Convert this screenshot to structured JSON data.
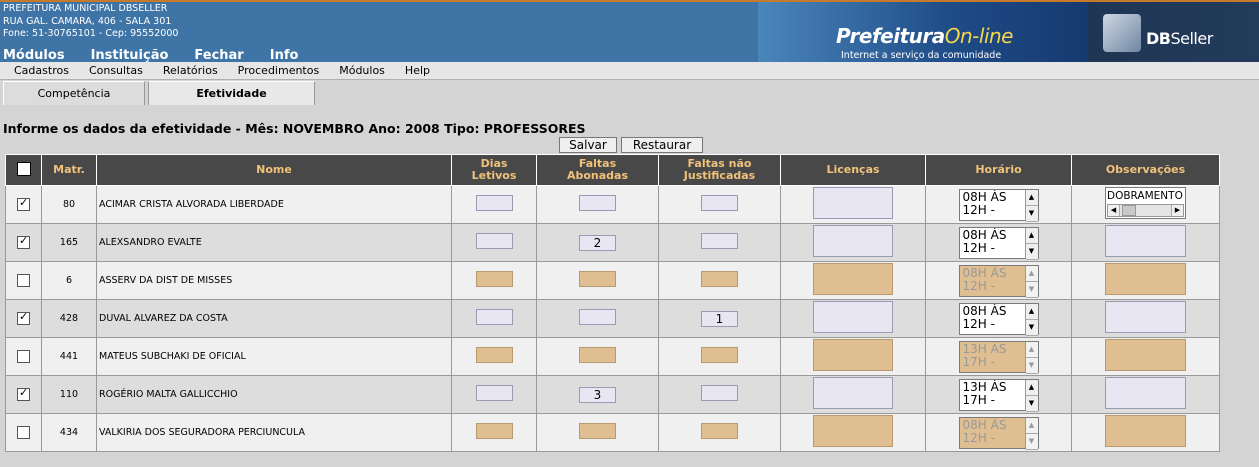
{
  "org": {
    "name": "PREFEITURA MUNICIPAL DBSELLER",
    "address": "RUA GAL. CAMARA, 406 - SALA 301",
    "phone": "Fone: 51-30765101  -  Cep: 95552000"
  },
  "main_menu": [
    "Módulos",
    "Instituição",
    "Fechar",
    "Info"
  ],
  "brand": {
    "prefix": "Prefeitura",
    "highlight": "On-line",
    "tagline": "Internet a serviço da comunidade",
    "vendor_db": "DB",
    "vendor_seller": "Seller"
  },
  "menubar": [
    "Cadastros",
    "Consultas",
    "Relatórios",
    "Procedimentos",
    "Módulos",
    "Help"
  ],
  "tabs": [
    "Competência",
    "Efetividade"
  ],
  "page_title": "Informe os dados da efetividade - Mês: NOVEMBRO Ano: 2008 Tipo: PROFESSORES",
  "buttons": {
    "save": "Salvar",
    "restore": "Restaurar"
  },
  "columns": {
    "matr": "Matr.",
    "nome": "Nome",
    "dias1": "Dias",
    "dias2": "Letivos",
    "fab1": "Faltas",
    "fab2": "Abonadas",
    "fnj1": "Faltas não",
    "fnj2": "Justificadas",
    "lic": "Licenças",
    "hor": "Horário",
    "obs": "Observações"
  },
  "rows": [
    {
      "checked": true,
      "matr": "80",
      "nome": "ACIMAR CRISTA ALVORADA LIBERDADE",
      "dias": "",
      "abonadas": "",
      "nao_just": "",
      "horario1": "08H ÀS",
      "horario2": "12H -",
      "obs": "DOBRAMENTO",
      "disabled": false
    },
    {
      "checked": true,
      "matr": "165",
      "nome": "ALEXSANDRO EVALTE",
      "dias": "",
      "abonadas": "2",
      "nao_just": "",
      "horario1": "08H ÀS",
      "horario2": "12H -",
      "obs": "",
      "disabled": false
    },
    {
      "checked": false,
      "matr": "6",
      "nome": "ASSERV DA DIST DE MISSES",
      "dias": "",
      "abonadas": "",
      "nao_just": "",
      "horario1": "08H ÀS",
      "horario2": "12H -",
      "obs": "",
      "disabled": true
    },
    {
      "checked": true,
      "matr": "428",
      "nome": "DUVAL ALVAREZ DA COSTA",
      "dias": "",
      "abonadas": "",
      "nao_just": "1",
      "horario1": "08H ÀS",
      "horario2": "12H -",
      "obs": "",
      "disabled": false
    },
    {
      "checked": false,
      "matr": "441",
      "nome": "MATEUS SUBCHAKI DE OFICIAL",
      "dias": "",
      "abonadas": "",
      "nao_just": "",
      "horario1": "13H ÀS",
      "horario2": "17H -",
      "obs": "",
      "disabled": true
    },
    {
      "checked": true,
      "matr": "110",
      "nome": "ROGÉRIO MALTA GALLICCHIO",
      "dias": "",
      "abonadas": "3",
      "nao_just": "",
      "horario1": "13H ÀS",
      "horario2": "17H -",
      "obs": "",
      "disabled": false
    },
    {
      "checked": false,
      "matr": "434",
      "nome": "VALKIRIA DOS SEGURADORA PERCIUNCULA",
      "dias": "",
      "abonadas": "",
      "nao_just": "",
      "horario1": "08H ÀS",
      "horario2": "12H -",
      "obs": "",
      "disabled": true
    }
  ]
}
